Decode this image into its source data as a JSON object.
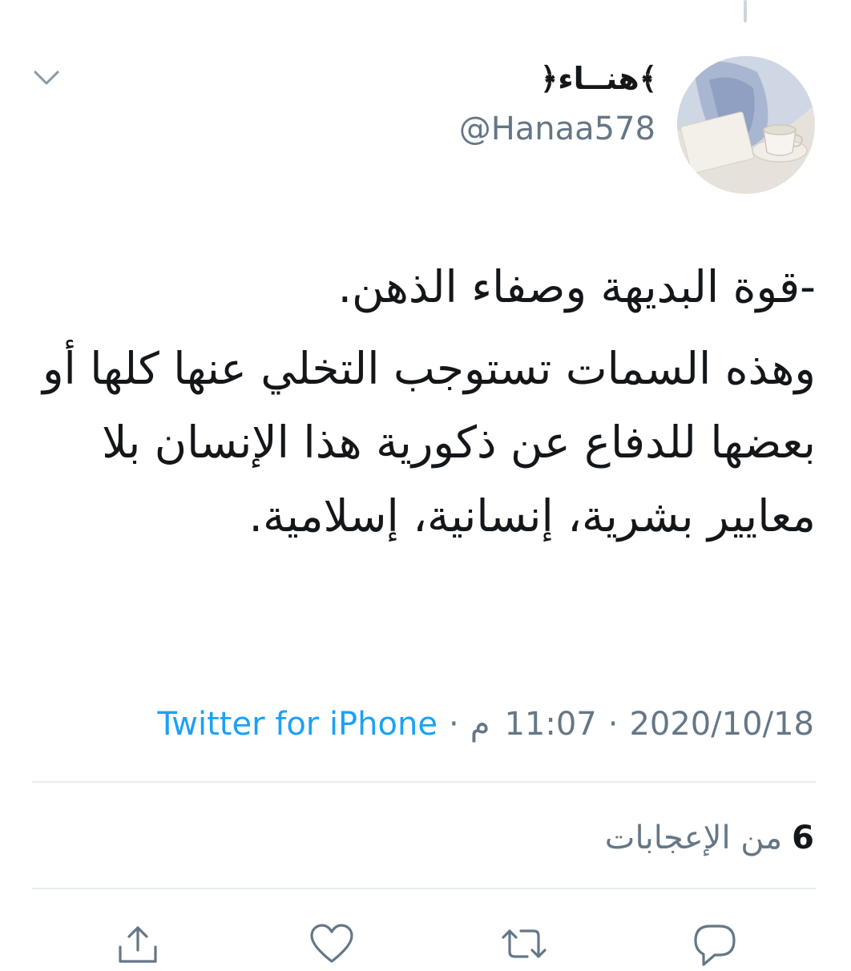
{
  "user": {
    "display_name": "﴾هنــاء﴿",
    "handle": "@Hanaa578"
  },
  "tweet": {
    "paragraphs": [
      "-قوة البديهة وصفاء الذهن.",
      "وهذه السمات تستوجب التخلي عنها كلها أو بعضها للدفاع عن ذكورية هذا الإنسان بلا معايير بشرية، إنسانية، إسلامية."
    ]
  },
  "meta": {
    "date": "2020/10/18",
    "time": "11:07",
    "period": "م",
    "separator": "·",
    "source": "Twitter for iPhone"
  },
  "stats": {
    "likes_count": "6",
    "likes_label": "من الإعجابات"
  },
  "icons": {
    "chevron": "chevron-down-icon",
    "share": "share-icon",
    "like": "heart-icon",
    "retweet": "retweet-icon",
    "reply": "reply-icon"
  },
  "colors": {
    "accent": "#1da1f2",
    "secondary_text": "#657786",
    "icon": "#657786",
    "divider": "#e6ecf0"
  }
}
